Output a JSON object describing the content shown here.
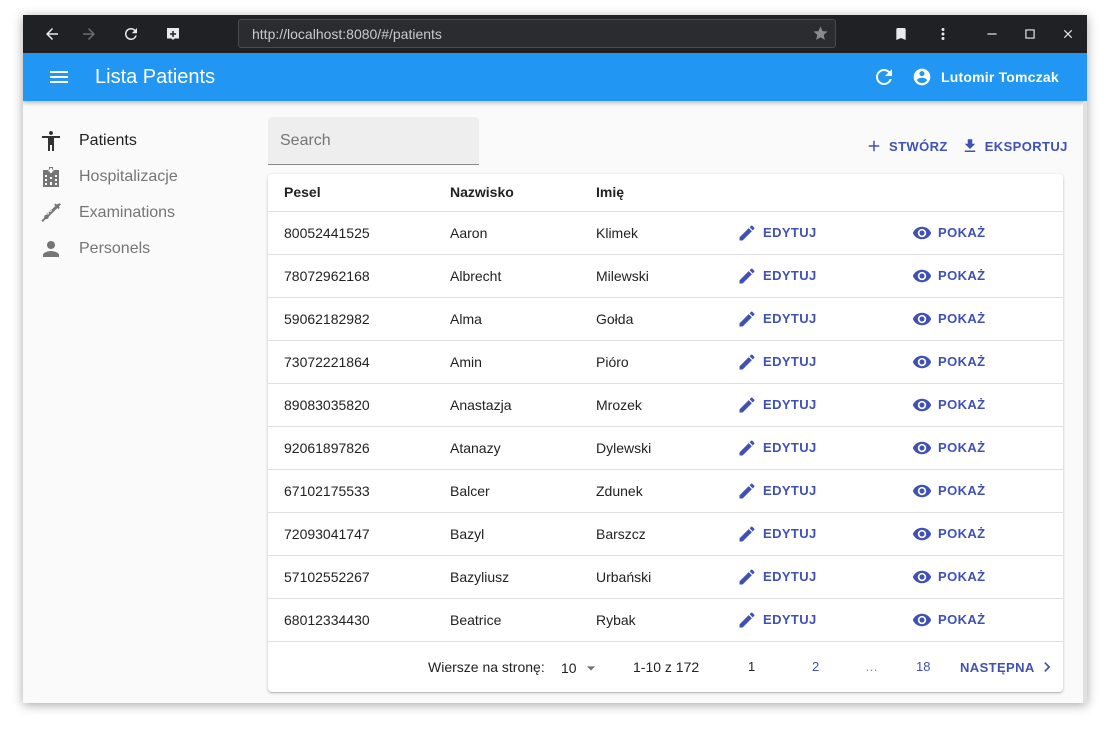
{
  "browser": {
    "url": "http://localhost:8080/#/patients"
  },
  "appbar": {
    "title": "Lista Patients",
    "user_name": "Lutomir Tomczak"
  },
  "sidebar": {
    "items": [
      {
        "label": "Patients",
        "icon": "accessibility-icon"
      },
      {
        "label": "Hospitalizacje",
        "icon": "hospital-building-icon"
      },
      {
        "label": "Examinations",
        "icon": "syringe-icon"
      },
      {
        "label": "Personels",
        "icon": "person-icon"
      }
    ]
  },
  "search": {
    "placeholder": "Search"
  },
  "actions": {
    "create": "STWÓRZ",
    "export": "EKSPORTUJ"
  },
  "table": {
    "headers": [
      "Pesel",
      "Nazwisko",
      "Imię"
    ],
    "edit_label": "EDYTUJ",
    "show_label": "POKAŻ",
    "rows": [
      {
        "pesel": "80052441525",
        "nazwisko": "Aaron",
        "imie": "Klimek"
      },
      {
        "pesel": "78072962168",
        "nazwisko": "Albrecht",
        "imie": "Milewski"
      },
      {
        "pesel": "59062182982",
        "nazwisko": "Alma",
        "imie": "Gołda"
      },
      {
        "pesel": "73072221864",
        "nazwisko": "Amin",
        "imie": "Pióro"
      },
      {
        "pesel": "89083035820",
        "nazwisko": "Anastazja",
        "imie": "Mrozek"
      },
      {
        "pesel": "92061897826",
        "nazwisko": "Atanazy",
        "imie": "Dylewski"
      },
      {
        "pesel": "67102175533",
        "nazwisko": "Balcer",
        "imie": "Zdunek"
      },
      {
        "pesel": "72093041747",
        "nazwisko": "Bazyl",
        "imie": "Barszcz"
      },
      {
        "pesel": "57102552267",
        "nazwisko": "Bazyliusz",
        "imie": "Urbański"
      },
      {
        "pesel": "68012334430",
        "nazwisko": "Beatrice",
        "imie": "Rybak"
      }
    ]
  },
  "pagination": {
    "rows_per_page_label": "Wiersze na stronę:",
    "rows_per_page": "10",
    "range": "1-10 z 172",
    "pages": [
      "1",
      "2",
      "…",
      "18"
    ],
    "current_page": "1",
    "next_label": "NASTĘPNA"
  },
  "colors": {
    "appbar": "#2196f3",
    "accent": "#3f51b5",
    "chrome": "#202124"
  }
}
